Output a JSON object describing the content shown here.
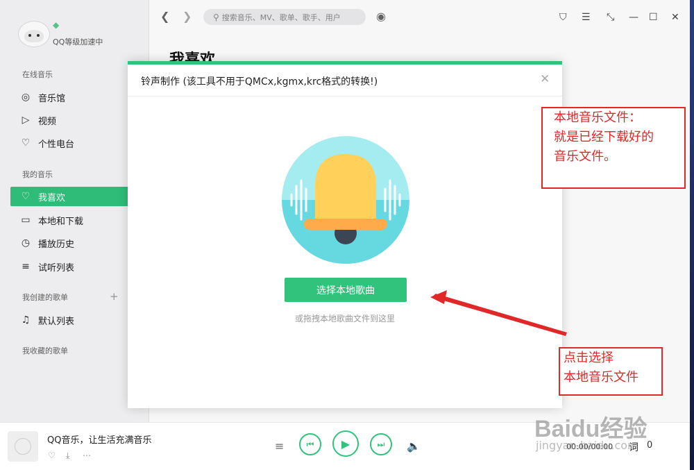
{
  "user": {
    "name": "QQ等级加速中",
    "vip_icon": "diamond-icon"
  },
  "sidebar": {
    "online_label": "在线音乐",
    "online": [
      {
        "label": "音乐馆",
        "icon": "music-hall-icon",
        "glyph": "◎"
      },
      {
        "label": "视频",
        "icon": "video-icon",
        "glyph": "▷"
      },
      {
        "label": "个性电台",
        "icon": "radio-heart-icon",
        "glyph": "♡"
      }
    ],
    "my_label": "我的音乐",
    "my": [
      {
        "label": "我喜欢",
        "icon": "heart-icon",
        "glyph": "♡",
        "active": true
      },
      {
        "label": "本地和下载",
        "icon": "computer-icon",
        "glyph": "▭"
      },
      {
        "label": "播放历史",
        "icon": "clock-icon",
        "glyph": "◷"
      },
      {
        "label": "试听列表",
        "icon": "playlist-icon",
        "glyph": "≡"
      }
    ],
    "created_label": "我创建的歌单",
    "created_add": "+",
    "created": [
      {
        "label": "默认列表",
        "icon": "note-icon",
        "glyph": "♫"
      }
    ],
    "collected_label": "我收藏的歌单"
  },
  "search": {
    "placeholder": "搜索音乐、MV、歌单、歌手、用户"
  },
  "main": {
    "title": "我喜欢"
  },
  "dialog": {
    "title": "铃声制作 (该工具不用于QMCx,kgmx,krc格式的转换!)",
    "button": "选择本地歌曲",
    "hint": "或拖拽本地歌曲文件到这里"
  },
  "annotations": {
    "box1": [
      "本地音乐文件：",
      "就是已经下载好的",
      "音乐文件。"
    ],
    "box2": [
      "点击选择",
      "本地音乐文件"
    ]
  },
  "player": {
    "song": "QQ音乐，让生活充满音乐",
    "time": "00:00/00:00",
    "lyric": "词",
    "queue": "0"
  },
  "watermark": {
    "logo": "Baidu经验",
    "sub": "jingyan.baidu.com"
  },
  "colors": {
    "accent": "#31c27c",
    "annotation": "#e02828"
  }
}
